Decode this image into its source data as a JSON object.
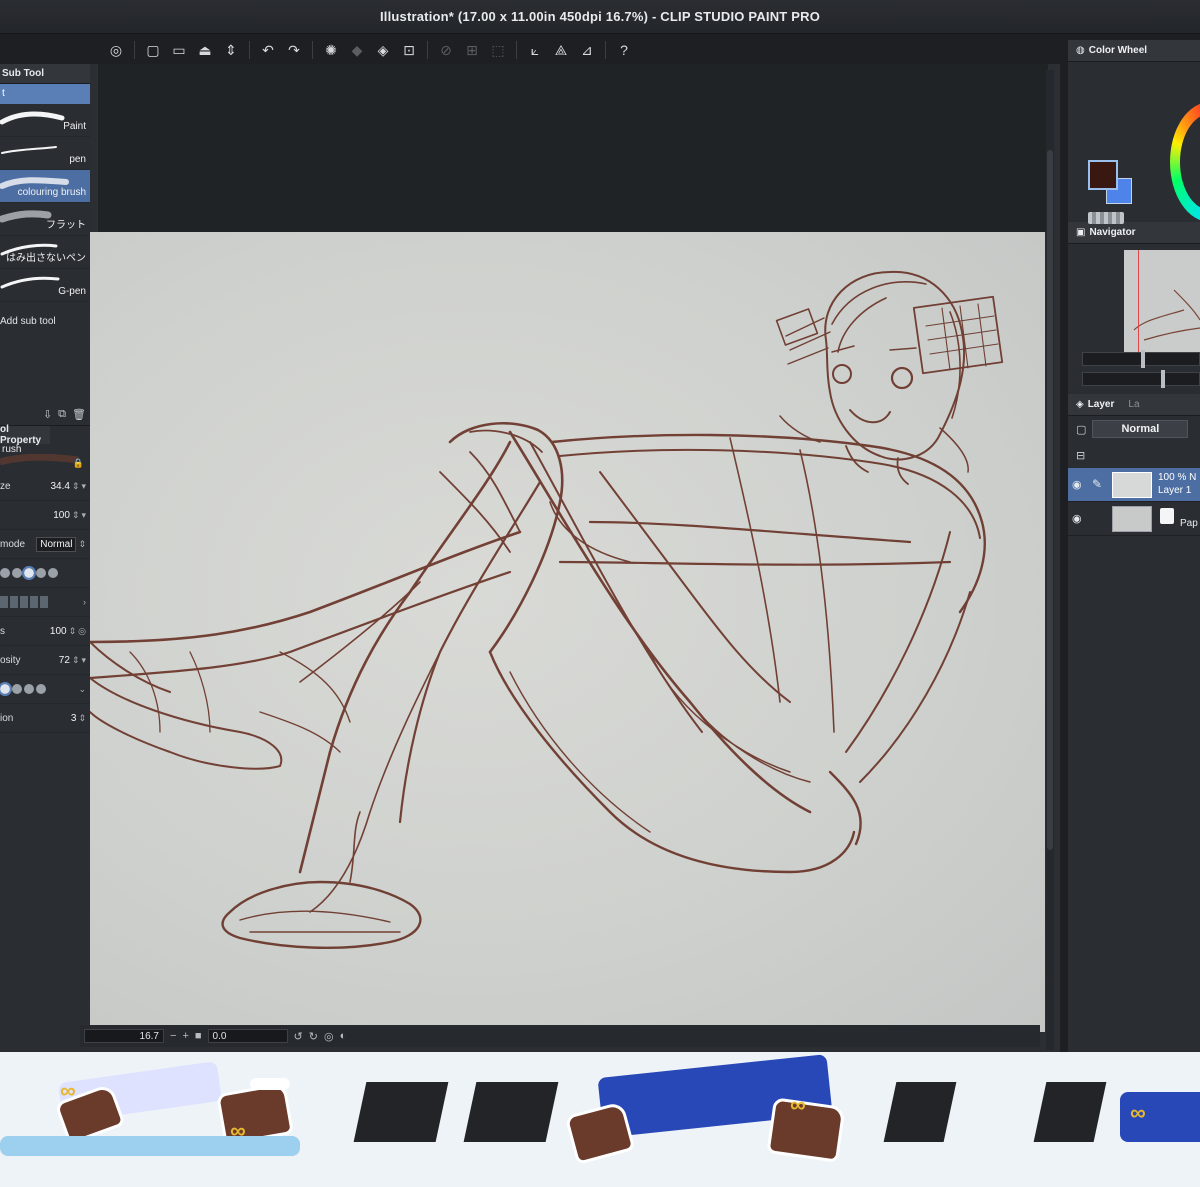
{
  "window": {
    "title": "Illustration* (17.00 x 11.00in 450dpi 16.7%)  - CLIP STUDIO PAINT PRO"
  },
  "toolbar": {
    "icons": [
      "app-icon",
      "new-icon",
      "open-icon",
      "save-icon",
      "undo-icon",
      "redo-icon",
      "loading-icon",
      "fill-icon",
      "transform-icon",
      "ruler-icon",
      "snap-icon",
      "help-icon"
    ]
  },
  "sub_tool": {
    "tab_label": "Sub Tool",
    "group_label": "t",
    "brushes": [
      {
        "label": "Paint",
        "selected": false
      },
      {
        "label": "pen",
        "selected": false
      },
      {
        "label": "colouring brush",
        "selected": true
      },
      {
        "label": "フラット",
        "selected": false
      },
      {
        "label": "はみ出さないペン",
        "selected": false
      },
      {
        "label": "G-pen",
        "selected": false
      }
    ],
    "add_label": "Add sub tool"
  },
  "tool_property": {
    "tab_label": "ol Property",
    "brush_name": "rush",
    "rows": [
      {
        "name": "ze",
        "value": "34.4"
      },
      {
        "name": "",
        "value": "100"
      },
      {
        "name": "mode",
        "value": "Normal"
      },
      {
        "name": "",
        "value": ""
      },
      {
        "name": "",
        "value": ""
      },
      {
        "name": "s",
        "value": "100"
      },
      {
        "name": "osity",
        "value": "72"
      },
      {
        "name": "",
        "value": ""
      },
      {
        "name": "ion",
        "value": "3"
      }
    ]
  },
  "status": {
    "zoom": "16.7",
    "angle": "0.0"
  },
  "color_panel": {
    "tab_label": "Color Wheel",
    "main_color": "#3a1812",
    "sub_color": "#4e83ea"
  },
  "navigator": {
    "tab_label": "Navigator"
  },
  "layer_panel": {
    "tab_label": "Layer",
    "tab2_label": "La",
    "blend_mode": "Normal",
    "layers": [
      {
        "line1": "100 % N",
        "line2": "Layer 1",
        "selected": true
      },
      {
        "line1": "",
        "line2": "Pap",
        "selected": false
      }
    ]
  }
}
